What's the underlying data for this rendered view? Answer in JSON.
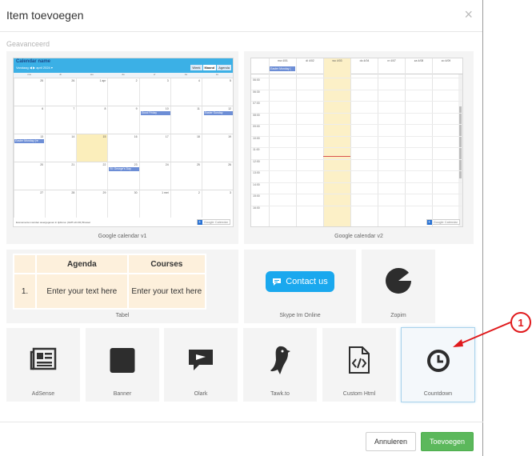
{
  "modal": {
    "title": "Item toevoegen",
    "close_glyph": "×",
    "section_label": "Geavanceerd"
  },
  "gcal_v1": {
    "caption": "Google calendar v1",
    "cal_name": "Calendar name",
    "nav": "Vandaag ◀ ▶ april 2024 ▾",
    "tabs": [
      "Week",
      "Maand",
      "Agenda"
    ],
    "active_tab": "Maand",
    "weekdays": [
      "ma",
      "di",
      "wo",
      "do",
      "vr",
      "za",
      "zo"
    ],
    "weeks": [
      [
        "25",
        "26",
        "1 apr",
        "2",
        "3",
        "4",
        "5"
      ],
      [
        "6",
        "7",
        "8",
        "9",
        "10",
        "11",
        "12"
      ],
      [
        "13",
        "14",
        "15",
        "16",
        "17",
        "18",
        "19"
      ],
      [
        "20",
        "21",
        "22",
        "23",
        "24",
        "25",
        "26"
      ],
      [
        "27",
        "28",
        "29",
        "30",
        "1 mei",
        "2",
        "3"
      ]
    ],
    "events": [
      "Good Friday",
      "Easter Sunday",
      "Easter Monday (re",
      "St. George's Day"
    ],
    "footer": "Evenementen worden weergegeven in tijdzone: (GMT+01:00) Brussel",
    "badge": "Google Calendar"
  },
  "gcal_v2": {
    "caption": "Google calendar v2",
    "days": [
      "ma 4/01",
      "di 4/02",
      "wo 4/03",
      "do 4/04",
      "vr 4/07",
      "za 4/08",
      "zo 4/09"
    ],
    "event": "Easter Monday (",
    "times": [
      "06:00",
      "06:30",
      "07:00",
      "08:00",
      "09:00",
      "10:00",
      "11:00",
      "12:00",
      "13:00",
      "14:00",
      "15:00",
      "16:00"
    ],
    "badge": "Google Calendar"
  },
  "tabel": {
    "caption": "Tabel",
    "headers": [
      "",
      "Agenda",
      "Courses"
    ],
    "row_num": "1.",
    "cell_a": "Enter your text here",
    "cell_b": "Enter your text here"
  },
  "skype": {
    "caption": "Skype Im Online",
    "button": "Contact us"
  },
  "zopim": {
    "caption": "Zopim"
  },
  "tiles": [
    {
      "key": "adsense",
      "caption": "AdSense",
      "icon": "newspaper-icon"
    },
    {
      "key": "banner",
      "caption": "Banner",
      "icon": "banner-square-icon"
    },
    {
      "key": "olark",
      "caption": "Olark",
      "icon": "chat-bubble-icon"
    },
    {
      "key": "tawk",
      "caption": "Tawk.to",
      "icon": "parrot-icon"
    },
    {
      "key": "custom",
      "caption": "Custom Html",
      "icon": "code-file-icon"
    },
    {
      "key": "countdown",
      "caption": "Countdown",
      "icon": "clock-icon"
    }
  ],
  "footer": {
    "cancel": "Annuleren",
    "add": "Toevoegen"
  },
  "annotation": {
    "number": "1",
    "color": "#e0191c"
  },
  "colors": {
    "add_button": "#5cb85c",
    "contact_button": "#1aa8ee",
    "table_fill": "#fdf0dc",
    "selected_outline": "#a9d3ec"
  }
}
